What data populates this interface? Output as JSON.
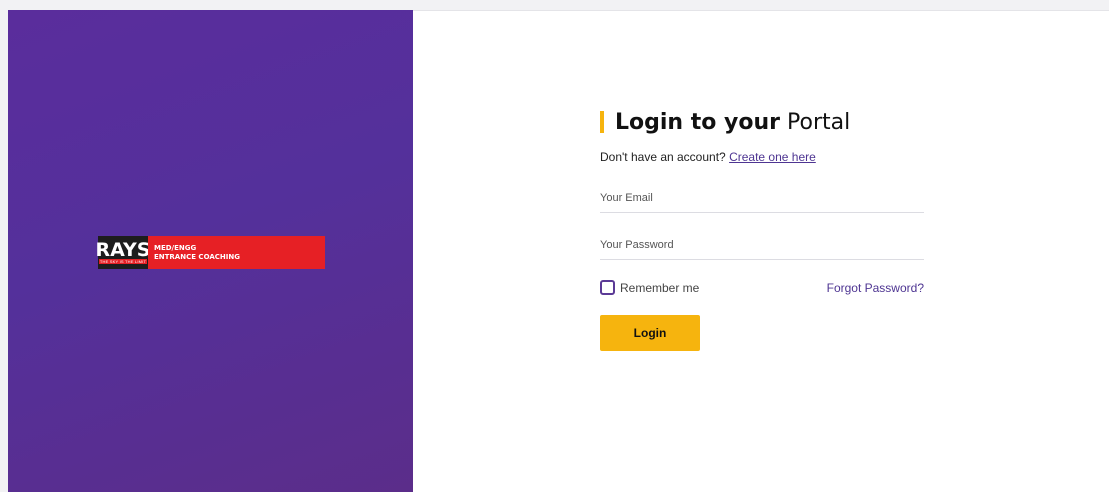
{
  "brand": {
    "logo_text": "RAYS",
    "logo_tagline": "THE SKY IS THE LIMIT",
    "logo_line1": "MED/ENGG",
    "logo_line2": "ENTRANCE COACHING",
    "panel_color": "#56309a"
  },
  "login": {
    "heading_bold": "Login to your",
    "heading_light": "Portal",
    "signup_prompt": "Don't have an account?",
    "signup_link": "Create one here",
    "email_placeholder": "Your Email",
    "password_placeholder": "Your Password",
    "remember_label": "Remember me",
    "forgot_label": "Forgot Password?",
    "submit_label": "Login",
    "accent_color": "#f6b40e",
    "link_color": "#4e3592"
  }
}
